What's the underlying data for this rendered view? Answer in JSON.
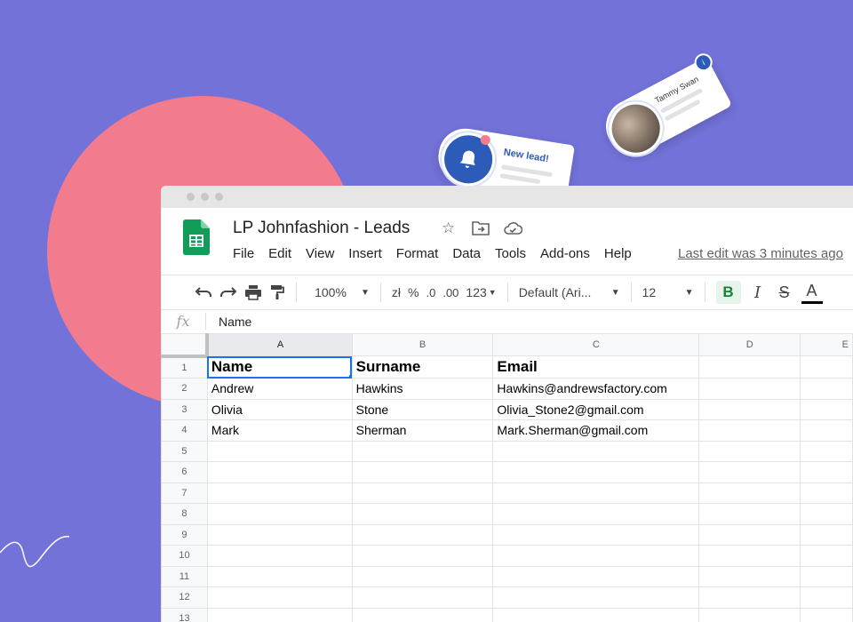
{
  "colors": {
    "background": "#7272d8",
    "blob": "#f27b8e",
    "accent": "#2d5bb8",
    "sheets_green": "#188038"
  },
  "notifications": {
    "lead_card": {
      "title": "New lead!",
      "icon": "bell-icon"
    },
    "tammy_card": {
      "name": "Tammy Swan",
      "badge": "i"
    }
  },
  "document": {
    "title": "LP Johnfashion - Leads"
  },
  "menu": [
    "File",
    "Edit",
    "View",
    "Insert",
    "Format",
    "Data",
    "Tools",
    "Add-ons",
    "Help"
  ],
  "last_edit": "Last edit was 3 minutes ago",
  "toolbar": {
    "zoom": "100%",
    "currency": "zł",
    "percent": "%",
    "decrease_decimals": ".0",
    "increase_decimals": ".00",
    "more_formats": "123",
    "font": "Default (Ari...",
    "font_size": "12",
    "bold": "B",
    "italic": "I",
    "strikethrough": "S",
    "text_color": "A"
  },
  "formula_bar": {
    "fx": "fx",
    "value": "Name"
  },
  "sheet": {
    "columns": [
      "A",
      "B",
      "C",
      "D",
      "E"
    ],
    "rows": [
      {
        "num": "1",
        "cells": [
          "Name",
          "Surname",
          "Email",
          "",
          ""
        ]
      },
      {
        "num": "2",
        "cells": [
          "Andrew",
          "Hawkins",
          "Hawkins@andrewsfactory.com",
          "",
          ""
        ]
      },
      {
        "num": "3",
        "cells": [
          "Olivia",
          "Stone",
          "Olivia_Stone2@gmail.com",
          "",
          ""
        ]
      },
      {
        "num": "4",
        "cells": [
          "Mark",
          "Sherman",
          "Mark.Sherman@gmail.com",
          "",
          ""
        ]
      },
      {
        "num": "5",
        "cells": [
          "",
          "",
          "",
          "",
          ""
        ]
      },
      {
        "num": "6",
        "cells": [
          "",
          "",
          "",
          "",
          ""
        ]
      },
      {
        "num": "7",
        "cells": [
          "",
          "",
          "",
          "",
          ""
        ]
      },
      {
        "num": "8",
        "cells": [
          "",
          "",
          "",
          "",
          ""
        ]
      },
      {
        "num": "9",
        "cells": [
          "",
          "",
          "",
          "",
          ""
        ]
      },
      {
        "num": "10",
        "cells": [
          "",
          "",
          "",
          "",
          ""
        ]
      },
      {
        "num": "11",
        "cells": [
          "",
          "",
          "",
          "",
          ""
        ]
      },
      {
        "num": "12",
        "cells": [
          "",
          "",
          "",
          "",
          ""
        ]
      },
      {
        "num": "13",
        "cells": [
          "",
          "",
          "",
          "",
          ""
        ]
      }
    ]
  }
}
